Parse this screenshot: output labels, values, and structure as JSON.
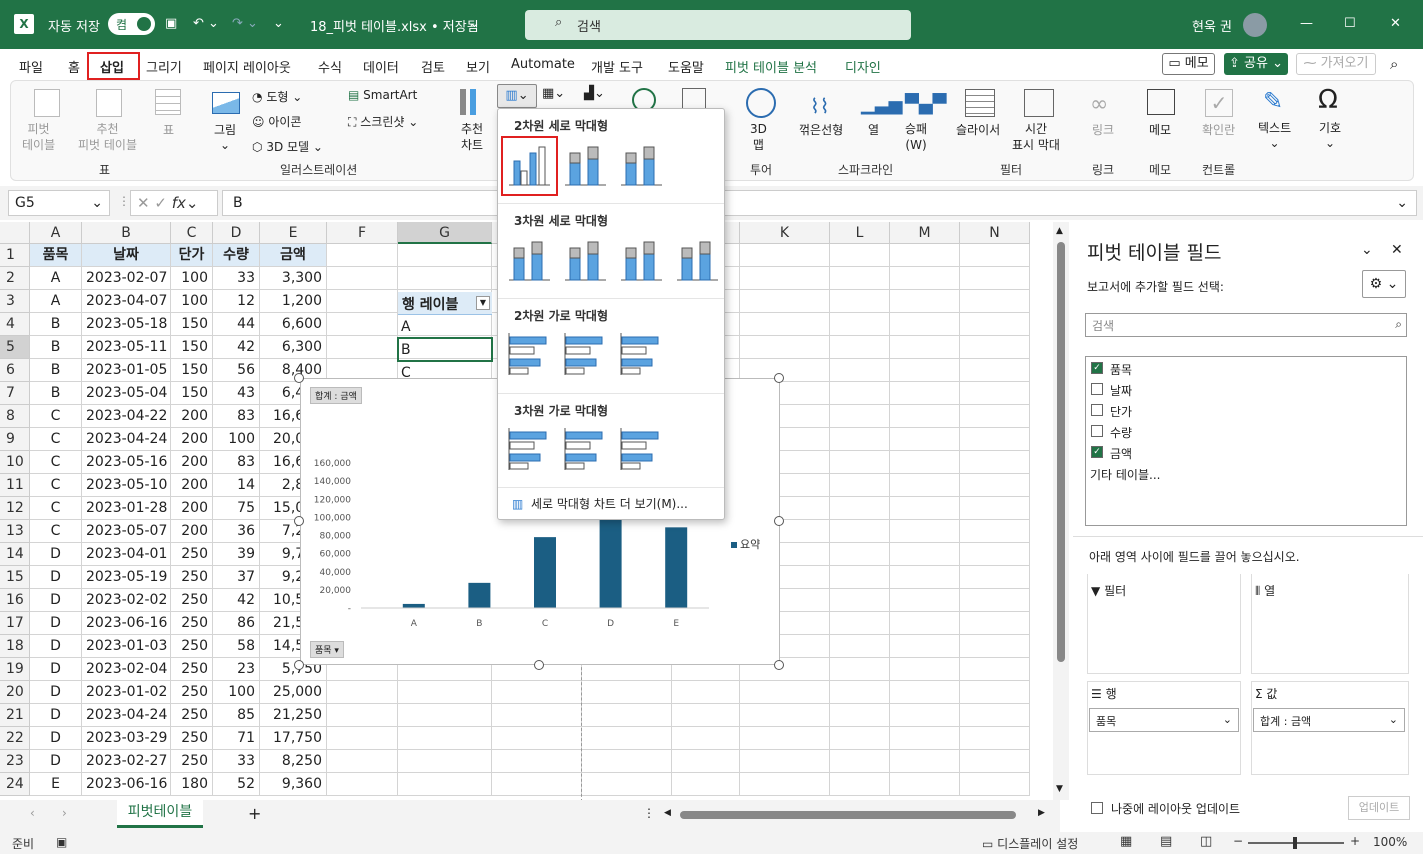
{
  "titlebar": {
    "autosave": "자동 저장",
    "toggle": "켬",
    "filename": "18_피벗 테이블.xlsx • 저장됨",
    "search": "검색",
    "user": "현욱 권"
  },
  "tabs": [
    "파일",
    "홈",
    "삽입",
    "그리기",
    "페이지 레이아웃",
    "수식",
    "데이터",
    "검토",
    "보기",
    "Automate",
    "개발 도구",
    "도움말",
    "피벗 테이블 분석",
    "디자인"
  ],
  "menu_right": {
    "memo": "메모",
    "share": "공유",
    "get": "가져오기"
  },
  "ribbon": {
    "pivot": "피벗\n테이블",
    "rec_pivot": "추천\n피벗 테이블",
    "table": "표",
    "picture": "그림",
    "shape": "도형",
    "icon": "아이콘",
    "model3d": "3D 모델",
    "smartart": "SmartArt",
    "screenshot": "스크린샷",
    "rec_chart": "추천\n차트",
    "map3d": "3D\n맵",
    "line": "꺾은선형",
    "col": "열",
    "winloss": "승패\n(W)",
    "slicer": "슬라이서",
    "timeline": "시간\n표시 막대",
    "link": "링크",
    "memo": "메모",
    "checkbox": "확인란",
    "text": "텍스트",
    "symbol": "기호",
    "grp_table": "표",
    "grp_illus": "일러스트레이션",
    "grp_tour": "투어",
    "grp_spark": "스파크라인",
    "grp_filter": "필터",
    "grp_link": "링크",
    "grp_memo": "메모",
    "grp_control": "컨트롤"
  },
  "formula": {
    "namebox": "G5",
    "fx": "fx",
    "value": "B"
  },
  "columns": [
    "A",
    "B",
    "C",
    "D",
    "E",
    "F",
    "G",
    "H",
    "I",
    "J",
    "K",
    "L",
    "M",
    "N"
  ],
  "header_row": [
    "품목",
    "날짜",
    "단가",
    "수량",
    "금액"
  ],
  "rows": [
    [
      "A",
      "2023-02-07",
      "100",
      "33",
      "3,300"
    ],
    [
      "A",
      "2023-04-07",
      "100",
      "12",
      "1,200"
    ],
    [
      "B",
      "2023-05-18",
      "150",
      "44",
      "6,600"
    ],
    [
      "B",
      "2023-05-11",
      "150",
      "42",
      "6,300"
    ],
    [
      "B",
      "2023-01-05",
      "150",
      "56",
      "8,400"
    ],
    [
      "B",
      "2023-05-04",
      "150",
      "43",
      "6,450"
    ],
    [
      "C",
      "2023-04-22",
      "200",
      "83",
      "16,600"
    ],
    [
      "C",
      "2023-04-24",
      "200",
      "100",
      "20,000"
    ],
    [
      "C",
      "2023-05-16",
      "200",
      "83",
      "16,600"
    ],
    [
      "C",
      "2023-05-10",
      "200",
      "14",
      "2,800"
    ],
    [
      "C",
      "2023-01-28",
      "200",
      "75",
      "15,000"
    ],
    [
      "C",
      "2023-05-07",
      "200",
      "36",
      "7,200"
    ],
    [
      "D",
      "2023-04-01",
      "250",
      "39",
      "9,750"
    ],
    [
      "D",
      "2023-05-19",
      "250",
      "37",
      "9,250"
    ],
    [
      "D",
      "2023-02-02",
      "250",
      "42",
      "10,500"
    ],
    [
      "D",
      "2023-06-16",
      "250",
      "86",
      "21,500"
    ],
    [
      "D",
      "2023-01-03",
      "250",
      "58",
      "14,500"
    ],
    [
      "D",
      "2023-02-04",
      "250",
      "23",
      "5,750"
    ],
    [
      "D",
      "2023-01-02",
      "250",
      "100",
      "25,000"
    ],
    [
      "D",
      "2023-04-24",
      "250",
      "85",
      "21,250"
    ],
    [
      "D",
      "2023-03-29",
      "250",
      "71",
      "17,750"
    ],
    [
      "D",
      "2023-02-27",
      "250",
      "33",
      "8,250"
    ],
    [
      "E",
      "2023-06-16",
      "180",
      "52",
      "9,360"
    ]
  ],
  "pivot": {
    "row_label": "행 레이블",
    "items": [
      "A",
      "B",
      "C"
    ]
  },
  "dropdown": {
    "h1": "2차원 세로 막대형",
    "h2": "3차원 세로 막대형",
    "h3": "2차원 가로 막대형",
    "h4": "3차원 가로 막대형",
    "more": "세로 막대형 차트 더 보기(M)..."
  },
  "chart_data": {
    "type": "bar",
    "categories": [
      "A",
      "B",
      "C",
      "D",
      "E"
    ],
    "values": [
      4500,
      27750,
      78200,
      143500,
      89000
    ],
    "ylim": [
      0,
      160000
    ],
    "yticks": [
      "160,000",
      "140,000",
      "120,000",
      "100,000",
      "80,000",
      "60,000",
      "40,000",
      "20,000",
      "-"
    ],
    "legend": "요약",
    "field_btn": "합계 : 금액",
    "axis_btn": "품목",
    "color": "#1b5e83"
  },
  "panel": {
    "title": "피벗 테이블 필드",
    "subtitle": "보고서에 추가할 필드 선택:",
    "search": "검색",
    "fields": [
      {
        "name": "품목",
        "checked": true
      },
      {
        "name": "날짜",
        "checked": false
      },
      {
        "name": "단가",
        "checked": false
      },
      {
        "name": "수량",
        "checked": false
      },
      {
        "name": "금액",
        "checked": true
      }
    ],
    "more": "기타 테이블...",
    "drag": "아래 영역 사이에 필드를 끌어 놓으십시오.",
    "filter": "필터",
    "col": "열",
    "row": "행",
    "value": "값",
    "row_field": "품목",
    "value_field": "합계 : 금액",
    "defer": "나중에 레이아웃 업데이트",
    "update": "업데이트"
  },
  "sheet": {
    "tab": "피벗테이블"
  },
  "status": {
    "ready": "준비",
    "display": "디스플레이 설정",
    "zoom": "100%"
  }
}
